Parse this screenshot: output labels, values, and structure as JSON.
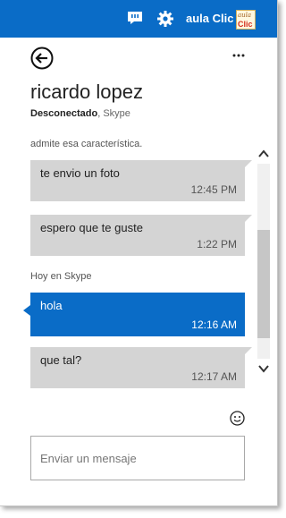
{
  "header": {
    "user_name": "aula Clic",
    "avatar_text_top": "aula",
    "avatar_text_bottom": "Clic",
    "accent_color": "#0a6cc7",
    "icons": [
      "message-icon",
      "gear-icon"
    ]
  },
  "conversation": {
    "contact_name": "ricardo lopez",
    "status": "Desconectado",
    "separator": ",",
    "network": "Skype",
    "system_text": "admite esa característica.",
    "day_label": "Hoy en Skype",
    "messages": [
      {
        "text": "te envio un foto",
        "time": "12:45 PM",
        "direction": "in"
      },
      {
        "text": "espero que te guste",
        "time": "1:22 PM",
        "direction": "in"
      },
      {
        "text": "hola",
        "time": "12:16 AM",
        "direction": "out"
      },
      {
        "text": "que tal?",
        "time": "12:17 AM",
        "direction": "in"
      }
    ]
  },
  "composer": {
    "placeholder": "Enviar un mensaje",
    "value": ""
  }
}
